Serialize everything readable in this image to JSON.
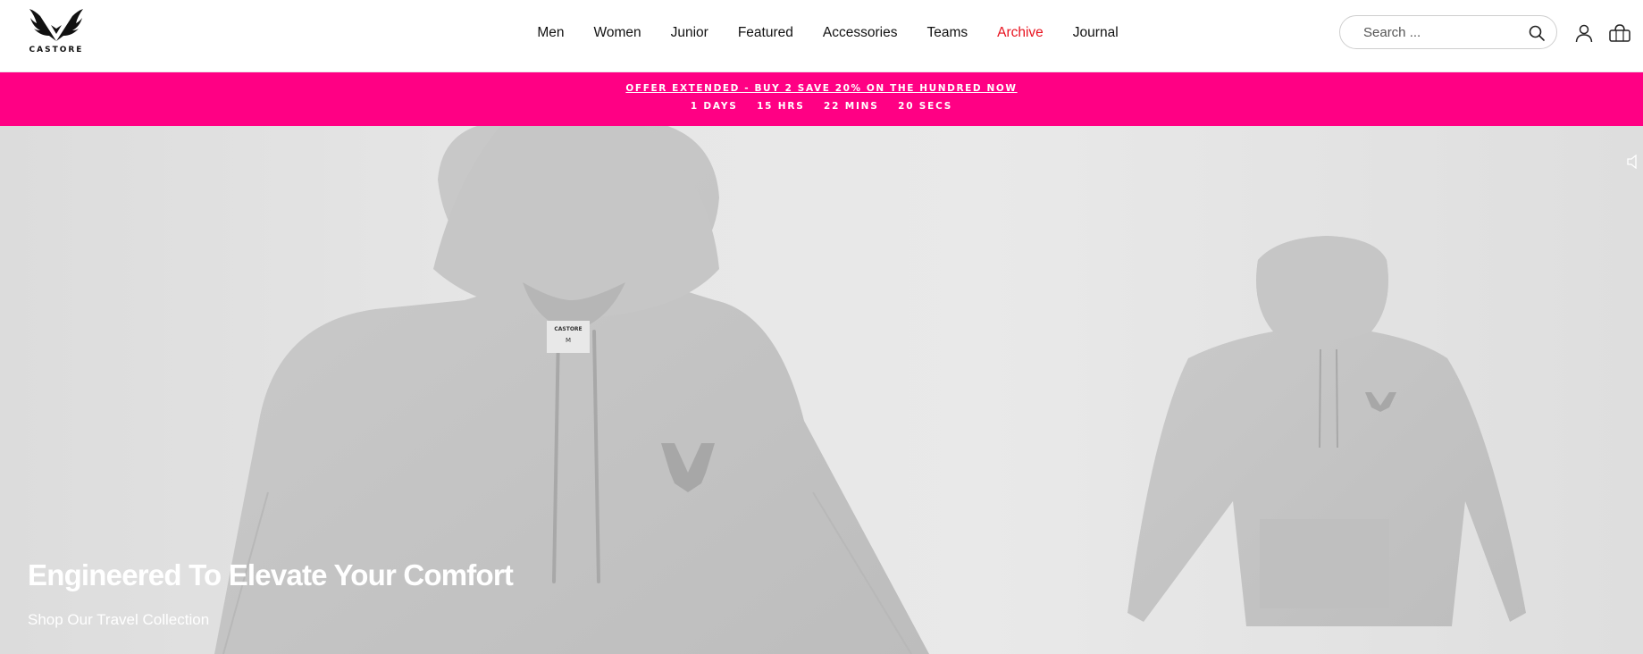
{
  "brand": {
    "logo_text": "CASTORE"
  },
  "nav": {
    "items": [
      {
        "label": "Men"
      },
      {
        "label": "Women"
      },
      {
        "label": "Junior"
      },
      {
        "label": "Featured"
      },
      {
        "label": "Accessories"
      },
      {
        "label": "Teams"
      },
      {
        "label": "Archive",
        "highlight": true
      },
      {
        "label": "Journal"
      }
    ]
  },
  "search": {
    "placeholder": "Search ..."
  },
  "icons": {
    "search": "search-icon",
    "account": "account-icon",
    "bag": "bag-icon",
    "mute": "mute-icon",
    "logo": "castore-wings-logo"
  },
  "promo": {
    "text": "OFFER EXTENDED - BUY 2 SAVE 20% ON THE HUNDRED NOW",
    "countdown": {
      "days": "1 DAYS",
      "hours": "15 HRS",
      "mins": "22 MINS",
      "secs": "20 SECS"
    }
  },
  "hero": {
    "title": "Engineered To Elevate Your Comfort",
    "cta": "Shop Our Travel Collection",
    "label_brand": "CASTORE",
    "label_size": "M"
  },
  "colors": {
    "promo_bg": "#ff0084",
    "archive_link": "#e8121e",
    "hero_bg": "#e6e6e6",
    "hoodie": "#c4c4c4"
  }
}
